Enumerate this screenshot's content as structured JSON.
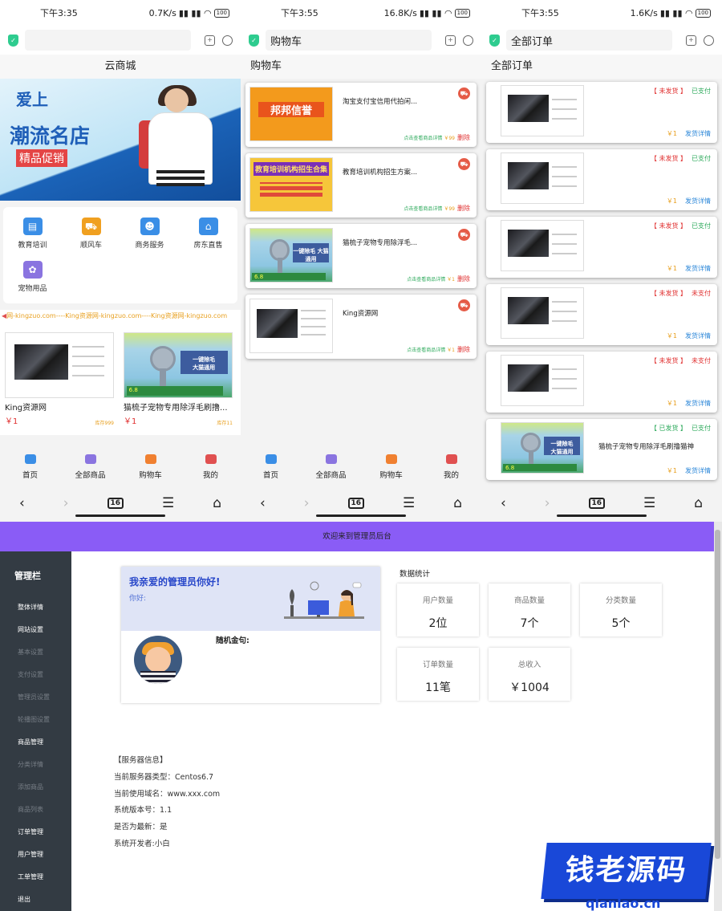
{
  "screen1": {
    "status": {
      "time": "下午3:35",
      "speed": "0.7K/s",
      "battery": "100"
    },
    "url": "",
    "page_title": "云商城",
    "banner": {
      "line1": "爱上",
      "line2": "潮流名店",
      "line3": "精品促销"
    },
    "categories": [
      {
        "label": "教育培训",
        "icon": "education-icon",
        "color": "#3a8ee6"
      },
      {
        "label": "顺风车",
        "icon": "car-icon",
        "color": "#f0a020"
      },
      {
        "label": "商务服务",
        "icon": "business-icon",
        "color": "#3a8ee6"
      },
      {
        "label": "房东直售",
        "icon": "house-icon",
        "color": "#3a8ee6"
      },
      {
        "label": "宠物用品",
        "icon": "pet-icon",
        "color": "#8a74e0"
      }
    ],
    "marquee": "网-kingzuo.com----King资源网-kingzuo.com----King资源网-kingzuo.com",
    "goods": [
      {
        "name": "King资源网",
        "price": "￥1",
        "sales": "库存999"
      },
      {
        "name": "猫梳子宠物专用除浮毛刷撸...",
        "price": "￥1",
        "sales": "库存11"
      }
    ]
  },
  "screen2": {
    "status": {
      "time": "下午3:55",
      "speed": "16.8K/s",
      "battery": "100"
    },
    "url": "购物车",
    "page_title": "购物车",
    "items": [
      {
        "name": "淘宝支付宝信用代拍闲...",
        "img_text": "邦邦信誉",
        "foot": "点击查看商品详情",
        "price": "￥99",
        "del": "删除"
      },
      {
        "name": "教育培训机构招生方案...",
        "img_text": "教育培训机构招生合集",
        "foot": "点击查看商品详情",
        "price": "￥99",
        "del": "删除"
      },
      {
        "name": "猫梳子宠物专用除浮毛...",
        "img_text": "一键除毛 大猫通用",
        "foot": "点击查看商品详情",
        "price": "￥1",
        "del": "删除"
      },
      {
        "name": "King资源网",
        "img_text": "",
        "foot": "点击查看商品详情",
        "price": "￥1",
        "del": "删除"
      }
    ]
  },
  "screen3": {
    "status": {
      "time": "下午3:55",
      "speed": "1.6K/s",
      "battery": "100"
    },
    "url": "全部订单",
    "page_title": "全部订单",
    "orders": [
      {
        "ship": "【 未发货 】",
        "pay": "已支付",
        "price": "￥1",
        "detail": "发货详情",
        "name": ""
      },
      {
        "ship": "【 未发货 】",
        "pay": "已支付",
        "price": "￥1",
        "detail": "发货详情",
        "name": ""
      },
      {
        "ship": "【 未发货 】",
        "pay": "已支付",
        "price": "￥1",
        "detail": "发货详情",
        "name": ""
      },
      {
        "ship": "【 未发货 】",
        "pay": "未支付",
        "price": "￥1",
        "detail": "发货详情",
        "name": ""
      },
      {
        "ship": "【 未发货 】",
        "pay": "未支付",
        "price": "￥1",
        "detail": "发货详情",
        "name": ""
      },
      {
        "ship": "【 已发货 】",
        "pay": "已支付",
        "price": "￥1",
        "detail": "发货详情",
        "name": "猫梳子宠物专用除浮毛刷撸猫神"
      }
    ]
  },
  "tabbar": [
    {
      "label": "首页",
      "color": "#3a8ee6"
    },
    {
      "label": "全部商品",
      "color": "#8a74e0"
    },
    {
      "label": "购物车",
      "color": "#f08030"
    },
    {
      "label": "我的",
      "color": "#e05050"
    }
  ],
  "nav": {
    "tabs": "16"
  },
  "admin": {
    "topbar": "欢迎来到管理员后台",
    "side_title": "管理栏",
    "side_items": [
      {
        "label": "整体详情",
        "dim": false
      },
      {
        "label": "网站设置",
        "dim": false
      },
      {
        "label": "基本设置",
        "dim": true
      },
      {
        "label": "支付设置",
        "dim": true
      },
      {
        "label": "管理员设置",
        "dim": true
      },
      {
        "label": "轮播图设置",
        "dim": true
      },
      {
        "label": "商品管理",
        "dim": false
      },
      {
        "label": "分类详情",
        "dim": true
      },
      {
        "label": "添加商品",
        "dim": true
      },
      {
        "label": "商品列表",
        "dim": true
      },
      {
        "label": "订单管理",
        "dim": false
      },
      {
        "label": "用户管理",
        "dim": false
      },
      {
        "label": "工单管理",
        "dim": false
      },
      {
        "label": "退出",
        "dim": false
      }
    ],
    "welcome_title": "我亲爱的管理员你好!",
    "welcome_sub": "你好:",
    "quote_label": "随机金句:",
    "stats_title": "数据统计",
    "stats": [
      {
        "label": "用户数量",
        "value": "2位"
      },
      {
        "label": "商品数量",
        "value": "7个"
      },
      {
        "label": "分类数量",
        "value": "5个"
      },
      {
        "label": "订单数量",
        "value": "11笔"
      },
      {
        "label": "总收入",
        "value": "￥1004"
      }
    ],
    "server": [
      "【服务器信息】",
      "当前服务器类型：Centos6.7",
      "当前使用域名：www.xxx.com",
      "系统版本号：1.1",
      "是否为最新：是",
      "系统开发者:小白"
    ]
  },
  "watermark": {
    "main": "钱老源码",
    "sub": "qianlao.cn"
  }
}
